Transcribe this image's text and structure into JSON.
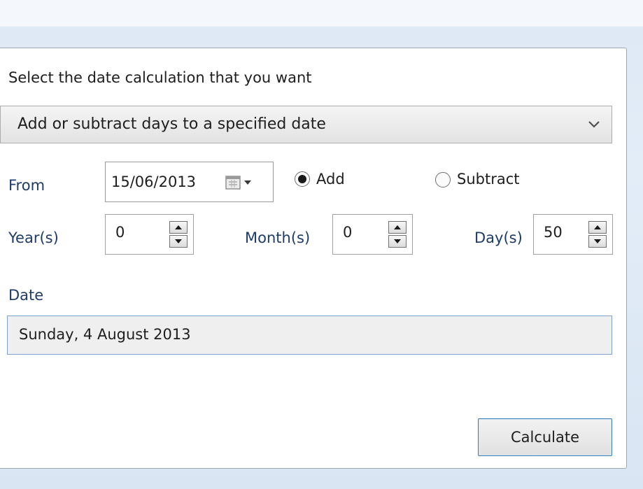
{
  "form": {
    "instruction_label": "Select the date calculation that you want",
    "calc_type": {
      "selected": "Add or subtract days to a specified date"
    },
    "from_label": "From",
    "from_date": "15/06/2013",
    "operation": {
      "add_label": "Add",
      "subtract_label": "Subtract",
      "selected": "Add"
    },
    "years": {
      "label": "Year(s)",
      "value": "0"
    },
    "months": {
      "label": "Month(s)",
      "value": "0"
    },
    "days": {
      "label": "Day(s)",
      "value": "50"
    },
    "date_label": "Date",
    "result_value": "Sunday, 4 August 2013",
    "calculate_label": "Calculate"
  },
  "icons": {
    "dropdown": "chevron-down-icon",
    "calendar": "calendar-icon",
    "spin_up": "arrow-up-icon",
    "spin_down": "arrow-down-icon"
  },
  "colors": {
    "accent_border": "#3c7fb1",
    "result_border": "#7da2ce",
    "label_blue": "#1e3c6b"
  }
}
